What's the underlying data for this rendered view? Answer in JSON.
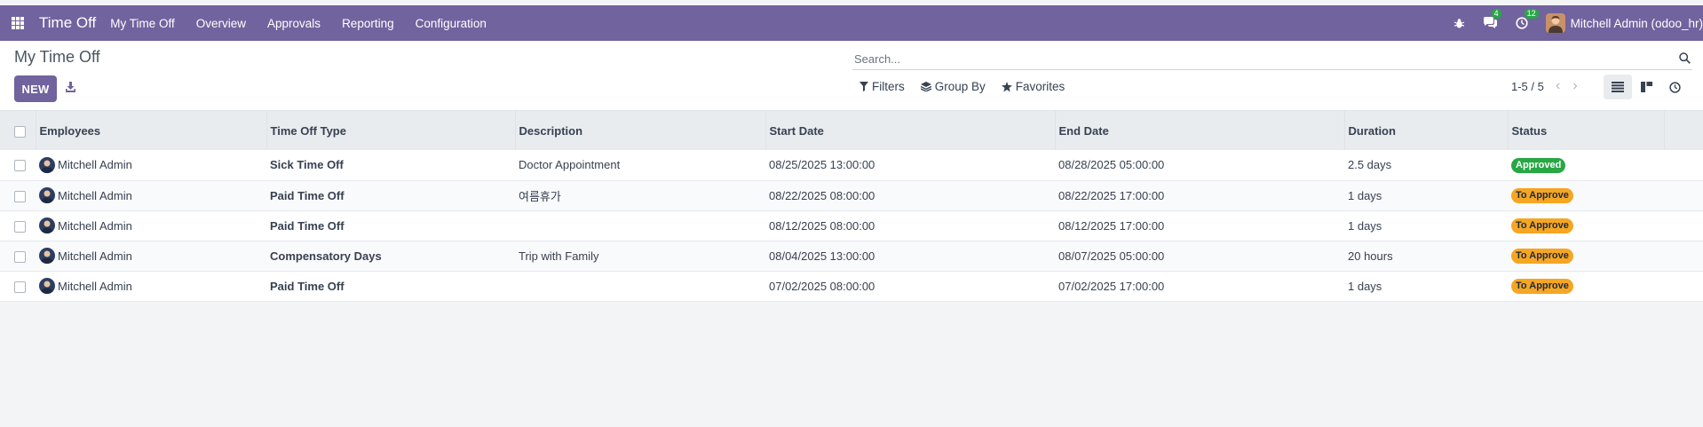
{
  "navbar": {
    "app_name": "Time Off",
    "menu": [
      "My Time Off",
      "Overview",
      "Approvals",
      "Reporting",
      "Configuration"
    ],
    "messages_count": "4",
    "activities_count": "12",
    "user": "Mitchell Admin (odoo_hr)"
  },
  "control": {
    "breadcrumb": "My Time Off",
    "new_label": "NEW",
    "search_placeholder": "Search...",
    "filters_label": "Filters",
    "groupby_label": "Group By",
    "favorites_label": "Favorites",
    "pager": "1-5 / 5"
  },
  "table": {
    "columns": [
      "Employees",
      "Time Off Type",
      "Description",
      "Start Date",
      "End Date",
      "Duration",
      "Status"
    ],
    "rows": [
      {
        "employee": "Mitchell Admin",
        "type": "Sick Time Off",
        "description": "Doctor Appointment",
        "start": "08/25/2025 13:00:00",
        "end": "08/28/2025 05:00:00",
        "duration": "2.5 days",
        "status": "Approved"
      },
      {
        "employee": "Mitchell Admin",
        "type": "Paid Time Off",
        "description": "여름휴가",
        "start": "08/22/2025 08:00:00",
        "end": "08/22/2025 17:00:00",
        "duration": "1 days",
        "status": "To Approve"
      },
      {
        "employee": "Mitchell Admin",
        "type": "Paid Time Off",
        "description": "",
        "start": "08/12/2025 08:00:00",
        "end": "08/12/2025 17:00:00",
        "duration": "1 days",
        "status": "To Approve"
      },
      {
        "employee": "Mitchell Admin",
        "type": "Compensatory Days",
        "description": "Trip with Family",
        "start": "08/04/2025 13:00:00",
        "end": "08/07/2025 05:00:00",
        "duration": "20 hours",
        "status": "To Approve"
      },
      {
        "employee": "Mitchell Admin",
        "type": "Paid Time Off",
        "description": "",
        "start": "07/02/2025 08:00:00",
        "end": "07/02/2025 17:00:00",
        "duration": "1 days",
        "status": "To Approve"
      }
    ]
  },
  "colors": {
    "brand": "#71639e",
    "approved": "#28a745",
    "to_approve": "#f5a623"
  }
}
